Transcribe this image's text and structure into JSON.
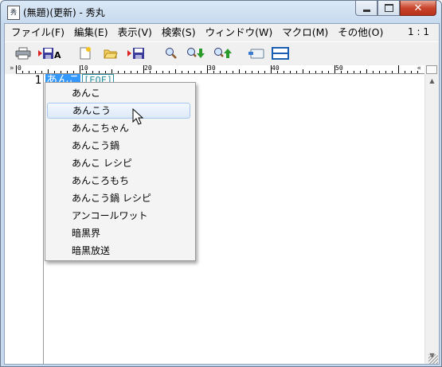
{
  "window": {
    "title": "(無題)(更新) - 秀丸",
    "app_icon_text": "秀",
    "close_glyph": "✕"
  },
  "menu": {
    "items": [
      "ファイル(F)",
      "編集(E)",
      "表示(V)",
      "検索(S)",
      "ウィンドウ(W)",
      "マクロ(M)",
      "その他(O)"
    ],
    "position": "1 : 1"
  },
  "toolbar": {
    "buttons": [
      "print-icon",
      "save-as-icon",
      "new-file-icon",
      "open-folder-icon",
      "save-icon",
      "search-icon",
      "search-down-icon",
      "search-up-icon",
      "paste-icon",
      "split-window-icon"
    ]
  },
  "ruler": {
    "left_mark": "»",
    "right_mark": "«",
    "numbers": [
      "0",
      "10",
      "20",
      "30",
      "40",
      "50"
    ]
  },
  "editor": {
    "line_number": "1",
    "selected_text": "あんこ",
    "eof_label": "[EOF]"
  },
  "popup": {
    "items": [
      "あんこ",
      "あんこう",
      "あんこちゃん",
      "あんこう鍋",
      "あんこ レシピ",
      "あんころもち",
      "あんこう鍋 レシピ",
      "アンコールワット",
      "暗黒界",
      "暗黒放送"
    ],
    "hovered_index": 1
  },
  "colors": {
    "selection": "#3399ff",
    "eof": "#2a90a0",
    "close_button": "#c8442c"
  }
}
